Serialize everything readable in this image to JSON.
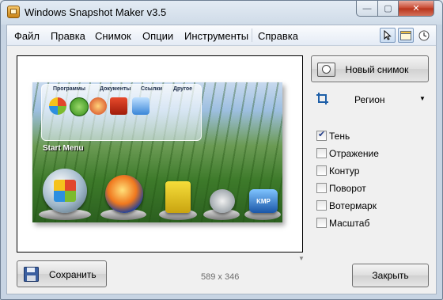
{
  "window": {
    "title": "Windows Snapshot Maker v3.5",
    "controls": {
      "minimize": "—",
      "maximize": "▢",
      "close": "✕"
    }
  },
  "menu": [
    "Файл",
    "Правка",
    "Снимок",
    "Опции",
    "Инструменты",
    "Справка"
  ],
  "toolbar": {
    "icons": [
      "cursor-icon",
      "window-icon",
      "timer-icon"
    ]
  },
  "preview": {
    "screenshot": {
      "panel_tabs": [
        "Программы",
        "Документы",
        "Ссылки",
        "Другое"
      ],
      "start_menu_label": "Start Menu",
      "dock_badge": "KMP"
    },
    "size_text": "589 x 346"
  },
  "actions": {
    "new_snapshot": "Новый снимок",
    "mode": "Регион",
    "save": "Сохранить",
    "close": "Закрыть"
  },
  "effects": [
    {
      "label": "Тень",
      "checked": true
    },
    {
      "label": "Отражение",
      "checked": false
    },
    {
      "label": "Контур",
      "checked": false
    },
    {
      "label": "Поворот",
      "checked": false
    },
    {
      "label": "Вотермарк",
      "checked": false
    },
    {
      "label": "Масштаб",
      "checked": false
    }
  ],
  "colors": {
    "accent": "#1e5fa8",
    "titlebar": "#cfdbe8"
  }
}
